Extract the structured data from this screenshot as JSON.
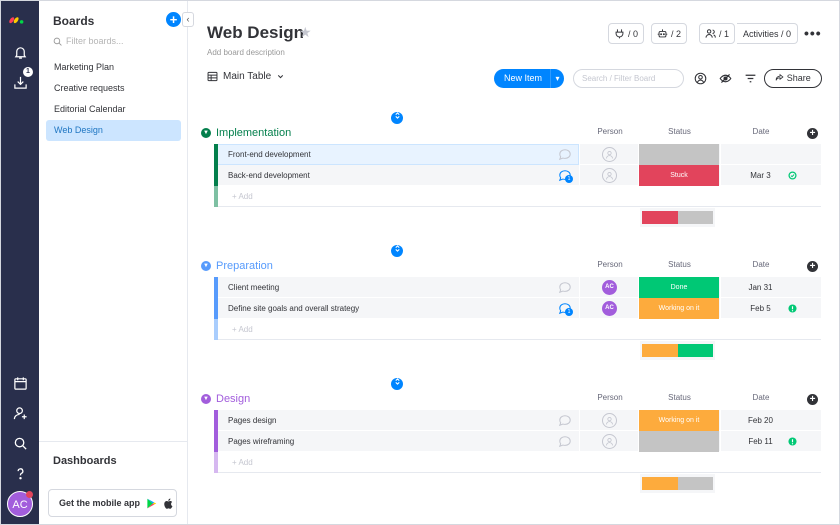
{
  "sidebar": {
    "title": "Boards",
    "add_label": "+",
    "collapse_label": "‹",
    "filter_placeholder": "Filter boards...",
    "items": [
      {
        "label": "Marketing Plan",
        "active": false
      },
      {
        "label": "Creative requests",
        "active": false
      },
      {
        "label": "Editorial Calendar",
        "active": false
      },
      {
        "label": "Web Design",
        "active": true
      }
    ],
    "dashboards_label": "Dashboards",
    "mobile_label": "Get the mobile app"
  },
  "rail": {
    "inbox_badge": "1",
    "avatar_initials": "AC",
    "icons": [
      "logo-icon",
      "bell-icon",
      "inbox-icon",
      "calendar-icon",
      "invite-user-icon",
      "search-icon",
      "help-icon"
    ]
  },
  "board": {
    "title": "Web Design",
    "star": "★",
    "description": "Add board description",
    "integrations_count": "/ 0",
    "automations_count": "/ 2",
    "members_count": "/ 1",
    "activities_label": "Activities / 0",
    "more_label": "•••",
    "view_label": "Main Table",
    "new_item_label": "New Item",
    "new_item_caret": "▾",
    "search_placeholder": "Search / Filter Board",
    "share_label": "Share"
  },
  "columns": {
    "person": "Person",
    "status": "Status",
    "date": "Date"
  },
  "add_label": "+ Add",
  "colors": {
    "blue": "#0085ff",
    "stuck": "#e2445c",
    "done": "#00c875",
    "working": "#fdab3d",
    "empty_status": "#c4c4c4",
    "implementation": "#037f4c",
    "preparation": "#579bfc",
    "design": "#a25ddc"
  },
  "groups": [
    {
      "name": "Implementation",
      "color": "#037f4c",
      "light": "#7ec0a3",
      "items": [
        {
          "name": "Front-end development",
          "person": "",
          "status": "",
          "status_color": "#c4c4c4",
          "date": "",
          "flag": "",
          "chat_count": "",
          "selected": true
        },
        {
          "name": "Back-end development",
          "person": "",
          "status": "Stuck",
          "status_color": "#e2445c",
          "date": "Mar 3",
          "flag": "#00c875",
          "flag_type": "ring",
          "chat_count": "1",
          "selected": false
        }
      ],
      "summary": [
        {
          "color": "#e2445c",
          "frac": 0.5
        },
        {
          "color": "#c4c4c4",
          "frac": 0.5
        }
      ]
    },
    {
      "name": "Preparation",
      "color": "#579bfc",
      "light": "#a9cdfd",
      "items": [
        {
          "name": "Client meeting",
          "person": "AC",
          "status": "Done",
          "status_color": "#00c875",
          "date": "Jan 31",
          "flag": "",
          "chat_count": "",
          "selected": false
        },
        {
          "name": "Define site goals and overall strategy",
          "person": "AC",
          "status": "Working on it",
          "status_color": "#fdab3d",
          "date": "Feb 5",
          "flag": "#00c875",
          "flag_type": "dot",
          "chat_count": "1",
          "selected": false
        }
      ],
      "summary": [
        {
          "color": "#fdab3d",
          "frac": 0.5
        },
        {
          "color": "#00c875",
          "frac": 0.5
        }
      ]
    },
    {
      "name": "Design",
      "color": "#a25ddc",
      "light": "#d6b8f0",
      "items": [
        {
          "name": "Pages design",
          "person": "",
          "status": "Working on it",
          "status_color": "#fdab3d",
          "date": "Feb 20",
          "flag": "",
          "chat_count": "",
          "selected": false
        },
        {
          "name": "Pages wireframing",
          "person": "",
          "status": "",
          "status_color": "#c4c4c4",
          "date": "Feb 11",
          "flag": "#00c875",
          "flag_type": "dot",
          "chat_count": "",
          "selected": false
        }
      ],
      "summary": [
        {
          "color": "#fdab3d",
          "frac": 0.5
        },
        {
          "color": "#c4c4c4",
          "frac": 0.5
        }
      ]
    }
  ]
}
